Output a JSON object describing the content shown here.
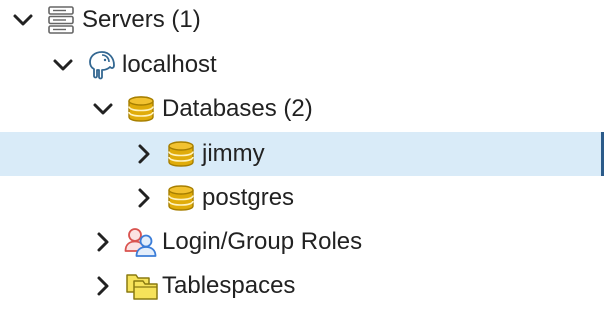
{
  "tree": {
    "items": [
      {
        "label": "Servers (1)",
        "expanded": true,
        "icon": "server-icon"
      },
      {
        "label": "localhost",
        "expanded": true,
        "icon": "postgres-elephant-icon"
      },
      {
        "label": "Databases (2)",
        "expanded": true,
        "icon": "databases-icon"
      },
      {
        "label": "jimmy",
        "expanded": false,
        "selected": true,
        "icon": "database-icon"
      },
      {
        "label": "postgres",
        "expanded": false,
        "icon": "database-icon"
      },
      {
        "label": "Login/Group Roles",
        "expanded": false,
        "icon": "roles-icon"
      },
      {
        "label": "Tablespaces",
        "expanded": false,
        "icon": "tablespaces-icon"
      }
    ]
  },
  "colors": {
    "selection_bg": "#d9ebf8",
    "selection_bar": "#2b5b8a",
    "db_gold": "#d9a400",
    "folder_yellow": "#f6e25a",
    "roles_red": "#d9534f",
    "roles_blue": "#3b7dd8"
  }
}
